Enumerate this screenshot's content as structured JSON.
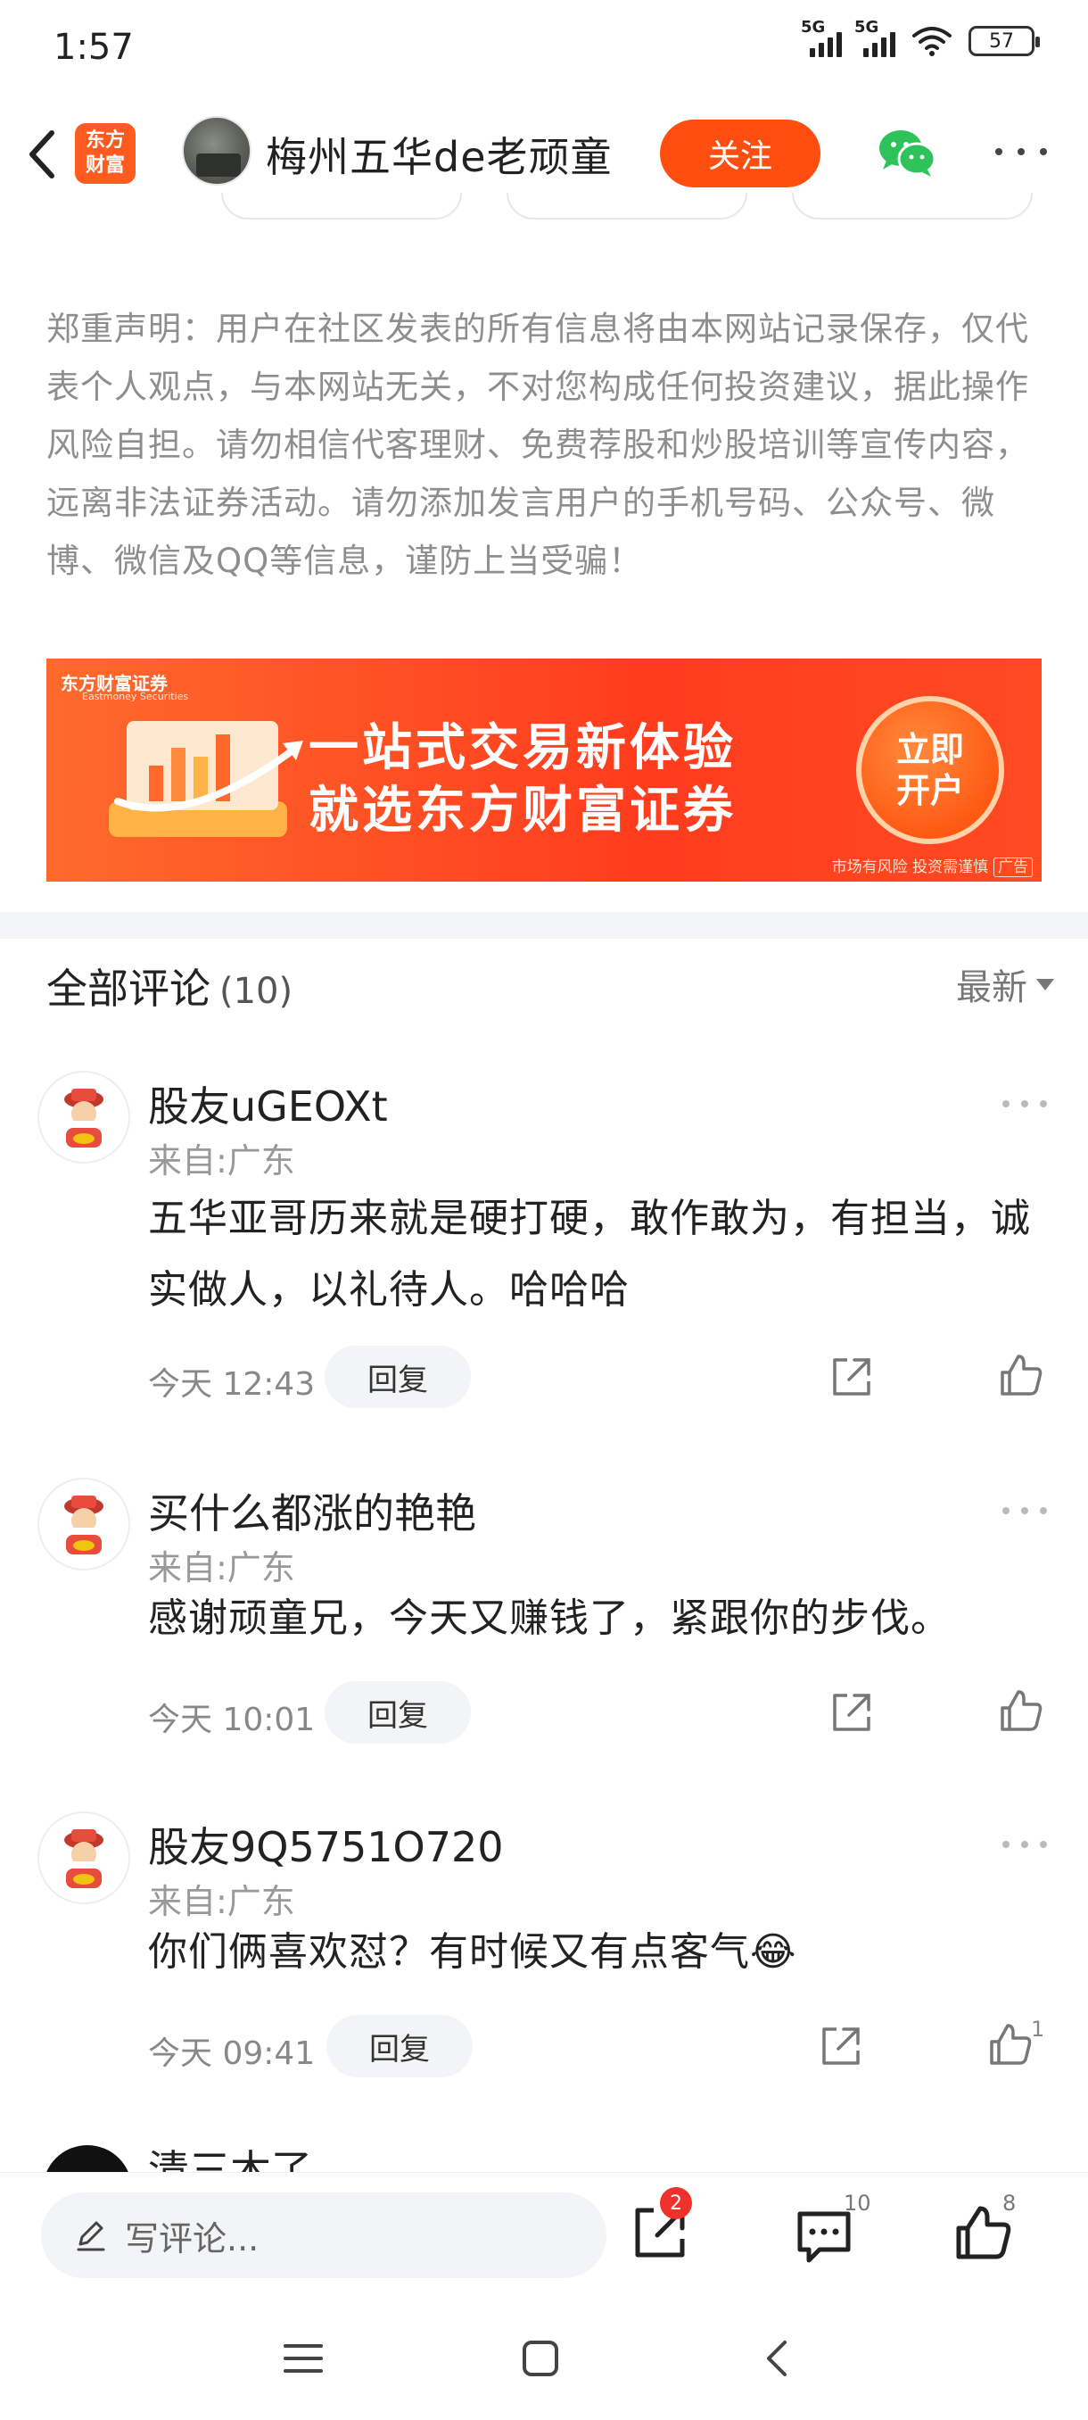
{
  "status_bar": {
    "time": "1:57",
    "signal1_tag": "5G",
    "signal2_tag": "5G",
    "battery": "57"
  },
  "nav": {
    "logo_line1": "东方",
    "logo_line2": "财富",
    "username": "梅州五华de老顽童",
    "follow_label": "关注"
  },
  "disclaimer": "郑重声明：用户在社区发表的所有信息将由本网站记录保存，仅代表个人观点，与本网站无关，不对您构成任何投资建议，据此操作风险自担。请勿相信代客理财、免费荐股和炒股培训等宣传内容，远离非法证券活动。请勿添加发言用户的手机号码、公众号、微博、微信及QQ等信息，谨防上当受骗！",
  "ad": {
    "brand": "东方财富证券",
    "brand_sub": "Eastmoney Securities",
    "line1": "一站式交易新体验",
    "line2": "就选东方财富证券",
    "cta_line1": "立即",
    "cta_line2": "开户",
    "risk": "市场有风险 投资需谨慎",
    "ad_tag": "广告"
  },
  "comments_section": {
    "title": "全部评论",
    "count": "(10)",
    "sort_label": "最新"
  },
  "comments": [
    {
      "name": "股友uGEOXt",
      "origin": "来自:广东",
      "text": "五华亚哥历来就是硬打硬，敢作敢为，有担当，诚实做人，以礼待人。哈哈哈",
      "time": "今天 12:43",
      "reply_label": "回复",
      "likes": ""
    },
    {
      "name": "买什么都涨的艳艳",
      "origin": "来自:广东",
      "text": "感谢顽童兄，今天又赚钱了，紧跟你的步伐。",
      "time": "今天 10:01",
      "reply_label": "回复",
      "likes": ""
    },
    {
      "name": "股友9Q5751O720",
      "origin": "来自:广东",
      "text": "你们俩喜欢怼？有时候又有点客气😂",
      "time": "今天 09:41",
      "reply_label": "回复",
      "likes": "1"
    }
  ],
  "cutoff_comment": {
    "name": "清三木了"
  },
  "bottom_bar": {
    "write_placeholder": "写评论...",
    "share_badge": "2",
    "comment_count": "10",
    "like_count": "8"
  },
  "colors": {
    "accent": "#ff4e10",
    "badge_red": "#f0302a",
    "wechat_green": "#2ec35a"
  }
}
